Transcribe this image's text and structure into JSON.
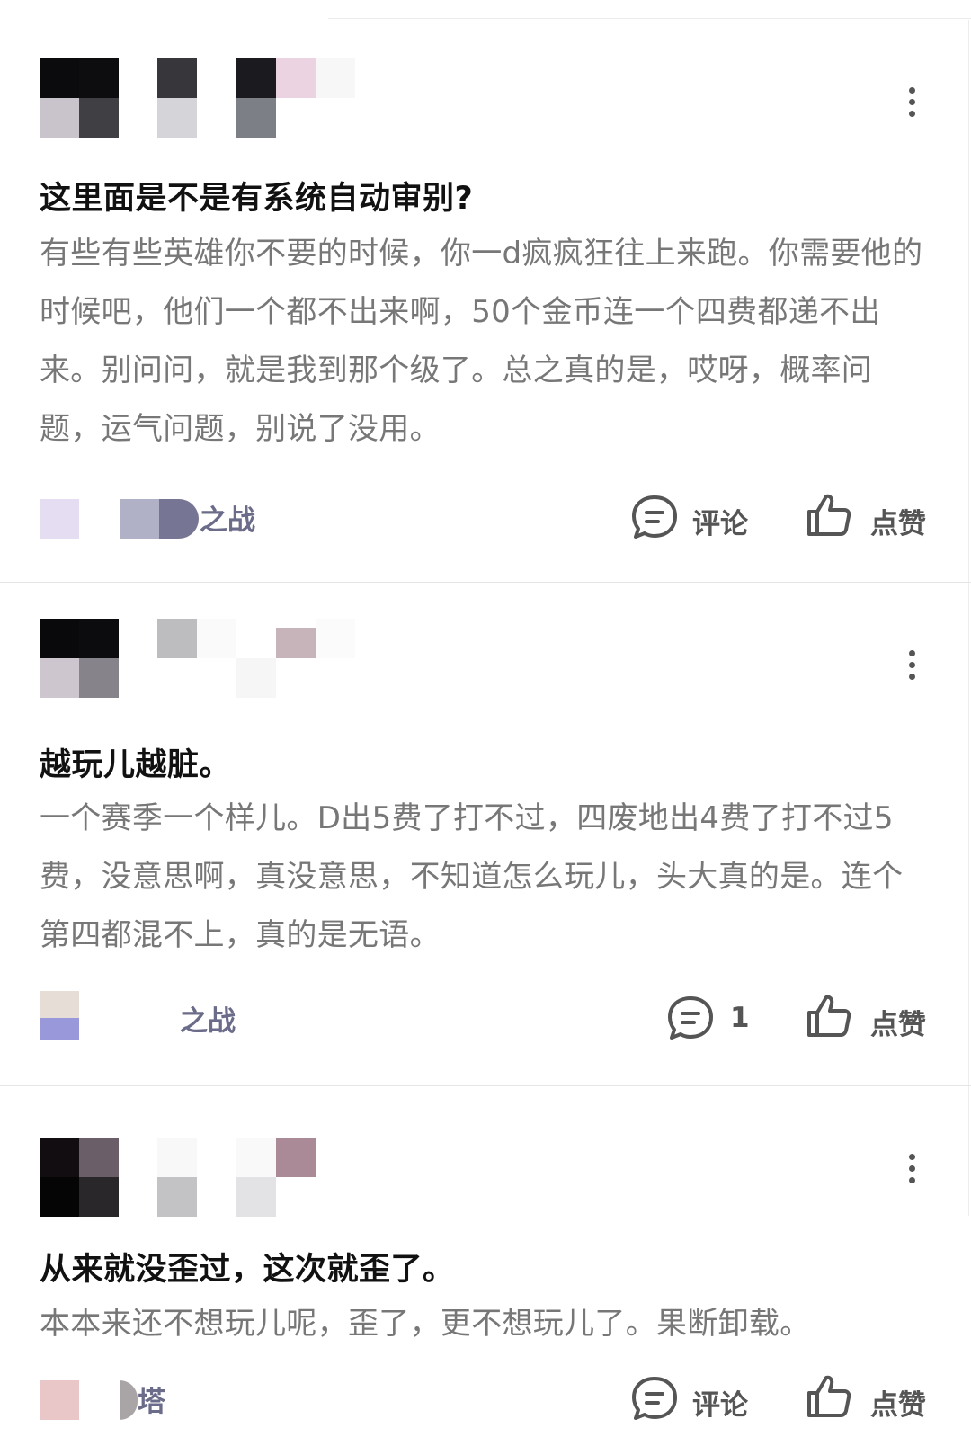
{
  "posts": [
    {
      "title": "这里面是不是有系统自动审别?",
      "body": "有些有些英雄你不要的时候，你一d疯疯狂往上来跑。你需要他的时候吧，他们一个都不出来啊，50个金币连一个四费都递不出来。别问问，就是我到那个级了。总之真的是，哎呀，概率问题，运气问题，别说了没用。",
      "tag_label": "之战",
      "comment_label": "评论",
      "like_label": "点赞"
    },
    {
      "title": "越玩儿越脏。",
      "body": "一个赛季一个样儿。D出5费了打不过，四废地出4费了打不过5费，没意思啊，真没意思，不知道怎么玩儿，头大真的是。连个第四都混不上，真的是无语。",
      "tag_label": "之战",
      "comment_label": "1",
      "like_label": "点赞"
    },
    {
      "title": "从来就没歪过，这次就歪了。",
      "body": "本本来还不想玩儿呢，歪了，更不想玩儿了。果断卸载。",
      "tag_label": "塔",
      "comment_label": "评论",
      "like_label": "点赞"
    }
  ],
  "colors": {
    "title": "#111111",
    "body": "#777777",
    "tag": "#6b6b8a",
    "action": "#555555",
    "divider": "#e6e6e6"
  },
  "icons": {
    "more": "more-vertical-icon",
    "comment": "comment-bubble-icon",
    "like": "thumbs-up-icon"
  }
}
